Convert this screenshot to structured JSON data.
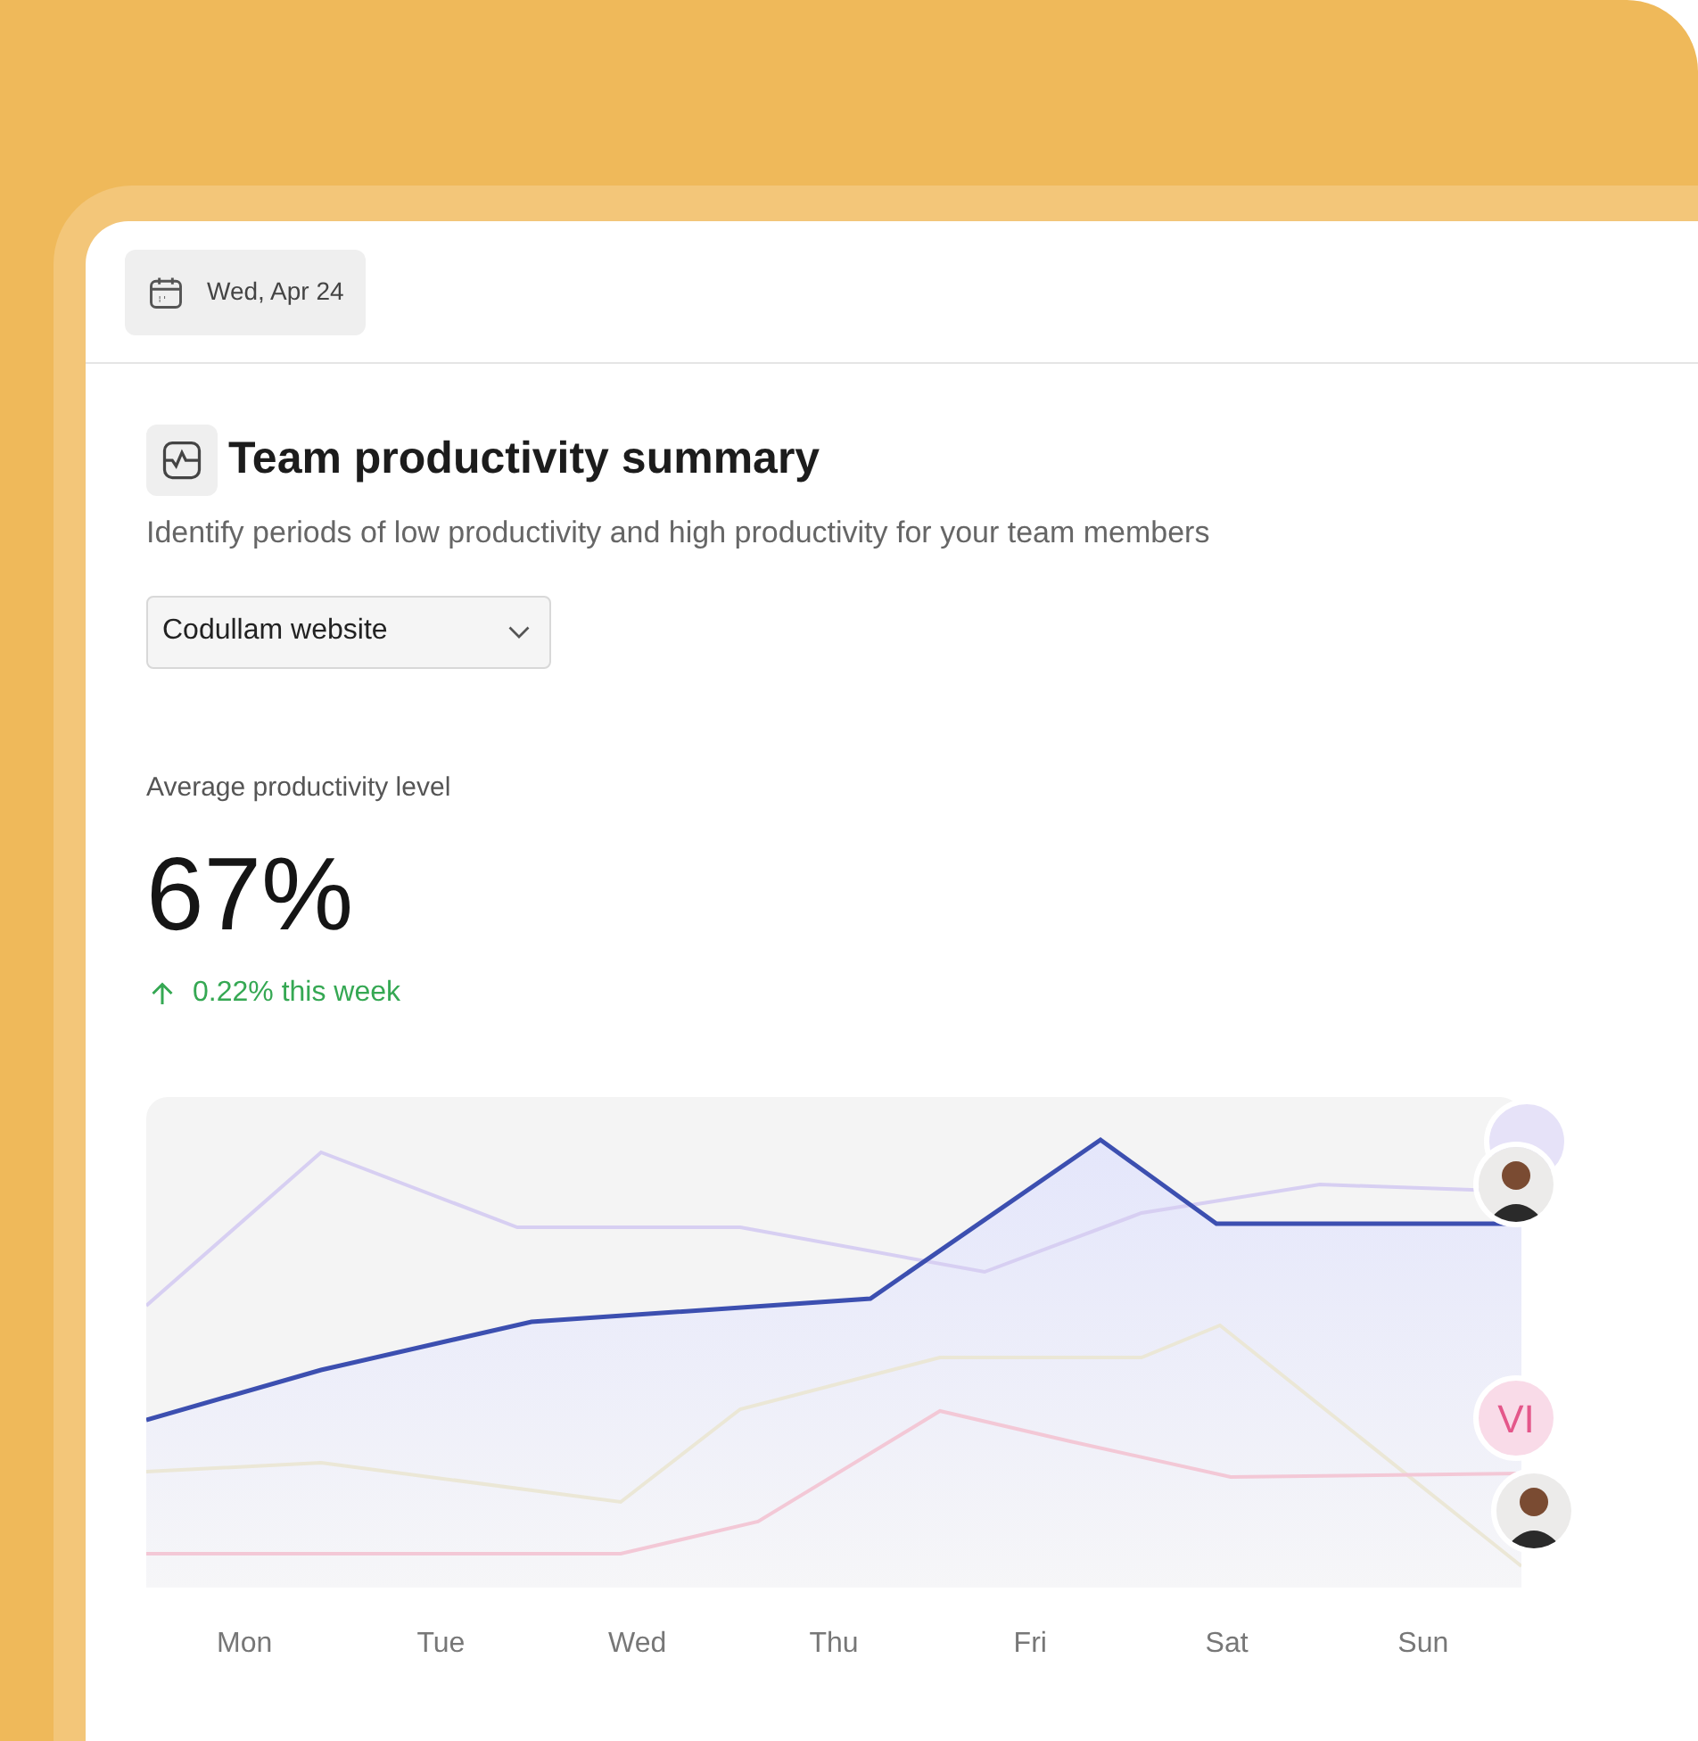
{
  "date_chip": {
    "label": "Wed, Apr 24"
  },
  "summary": {
    "title": "Team productivity summary",
    "subtitle": "Identify periods of low productivity and high productivity for your team members"
  },
  "project_select": {
    "value": "Codullam website"
  },
  "metric": {
    "label": "Average productivity level",
    "value": "67%",
    "change": "0.22% this week"
  },
  "chart": {
    "days": [
      "Mon",
      "Tue",
      "Wed",
      "Thu",
      "Fri",
      "Sat",
      "Sun"
    ],
    "avatars": [
      {
        "kind": "blank",
        "color": "#e6e2f8"
      },
      {
        "kind": "photo"
      },
      {
        "kind": "initials",
        "initials": "VI",
        "color": "#f9dbe8"
      },
      {
        "kind": "photo"
      }
    ]
  }
}
